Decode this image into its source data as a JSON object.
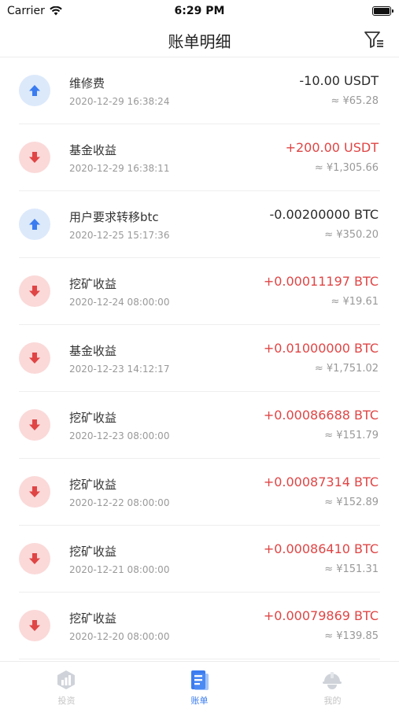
{
  "status_bar": {
    "carrier": "Carrier",
    "time": "6:29 PM"
  },
  "header": {
    "title": "账单明细",
    "filter_icon": "filter-icon"
  },
  "colors": {
    "accent": "#3b7cf0",
    "positive": "#e04545",
    "negative": "#2b2b2b",
    "out_badge": "#dce9fb",
    "in_badge": "#fbd9d9"
  },
  "transactions": [
    {
      "direction": "out",
      "title": "维修费",
      "date": "2020-12-29 16:38:24",
      "amount": "-10.00 USDT",
      "approx": "≈ ¥65.28"
    },
    {
      "direction": "in",
      "title": "基金收益",
      "date": "2020-12-29 16:38:11",
      "amount": "+200.00 USDT",
      "approx": "≈ ¥1,305.66"
    },
    {
      "direction": "out",
      "title": "用户要求转移btc",
      "date": "2020-12-25 15:17:36",
      "amount": "-0.00200000 BTC",
      "approx": "≈ ¥350.20"
    },
    {
      "direction": "in",
      "title": "挖矿收益",
      "date": "2020-12-24 08:00:00",
      "amount": "+0.00011197 BTC",
      "approx": "≈ ¥19.61"
    },
    {
      "direction": "in",
      "title": "基金收益",
      "date": "2020-12-23 14:12:17",
      "amount": "+0.01000000 BTC",
      "approx": "≈ ¥1,751.02"
    },
    {
      "direction": "in",
      "title": "挖矿收益",
      "date": "2020-12-23 08:00:00",
      "amount": "+0.00086688 BTC",
      "approx": "≈ ¥151.79"
    },
    {
      "direction": "in",
      "title": "挖矿收益",
      "date": "2020-12-22 08:00:00",
      "amount": "+0.00087314 BTC",
      "approx": "≈ ¥152.89"
    },
    {
      "direction": "in",
      "title": "挖矿收益",
      "date": "2020-12-21 08:00:00",
      "amount": "+0.00086410 BTC",
      "approx": "≈ ¥151.31"
    },
    {
      "direction": "in",
      "title": "挖矿收益",
      "date": "2020-12-20 08:00:00",
      "amount": "+0.00079869 BTC",
      "approx": "≈ ¥139.85"
    }
  ],
  "tabbar": {
    "tabs": [
      {
        "label": "投资",
        "icon": "chart-icon",
        "active": false
      },
      {
        "label": "账单",
        "icon": "bill-icon",
        "active": true
      },
      {
        "label": "我的",
        "icon": "helmet-icon",
        "active": false
      }
    ]
  }
}
